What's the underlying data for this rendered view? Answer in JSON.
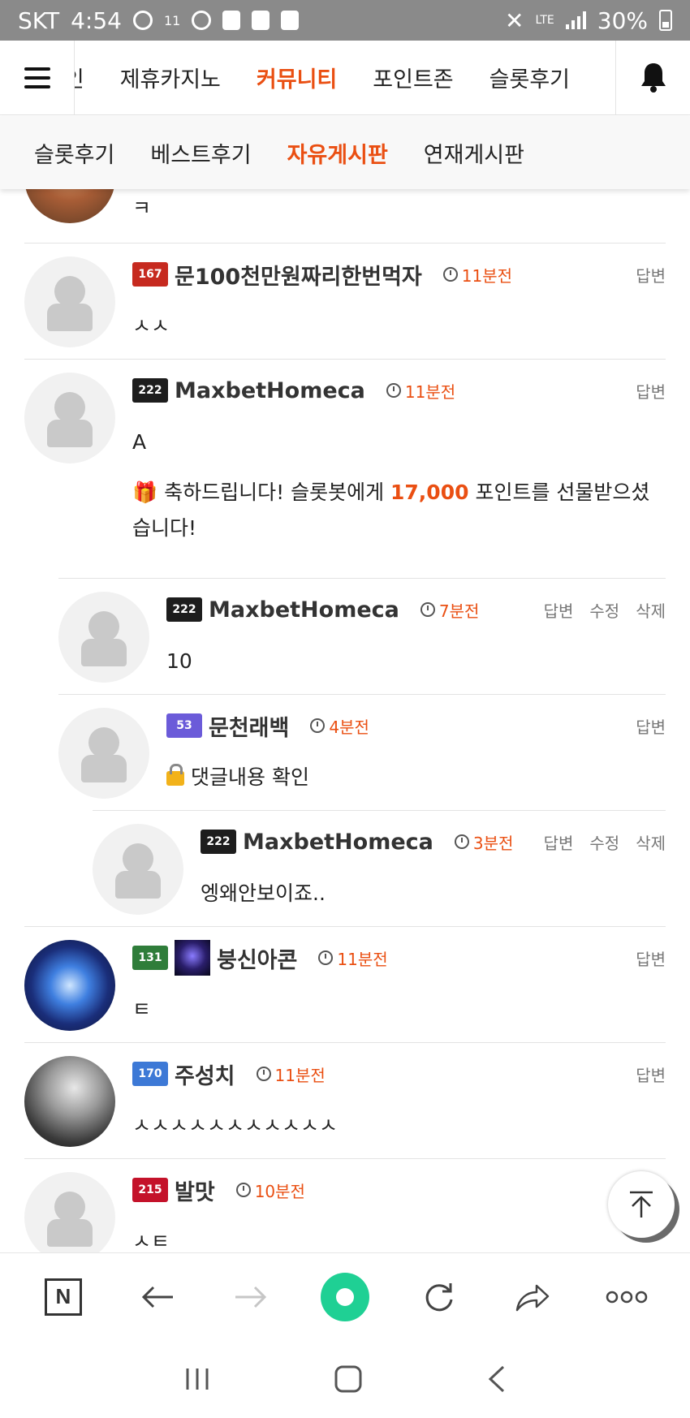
{
  "status_bar": {
    "carrier": "SKT",
    "time": "4:54",
    "indicator": "11",
    "network": "LTE",
    "battery": "30%"
  },
  "main_nav": {
    "items": [
      "메인",
      "제휴카지노",
      "커뮤니티",
      "포인트존",
      "슬롯후기"
    ],
    "active": "커뮤니티"
  },
  "sub_nav": {
    "items": [
      "슬롯후기",
      "베스트후기",
      "자유게시판",
      "연재게시판"
    ],
    "active": "자유게시판"
  },
  "comments": [
    {
      "text": "ㅋ"
    },
    {
      "level": "167",
      "username": "문100천만원짜리한번먹자",
      "time": "11분전",
      "text": "ㅅㅅ",
      "actions": [
        "답변"
      ]
    },
    {
      "level": "222",
      "username": "MaxbetHomeca",
      "time": "11분전",
      "text": "A",
      "gift": {
        "prefix": "축하드립니다! 슬롯봇에게 ",
        "points": "17,000",
        "suffix": " 포인트를 선물받으셨습니다!"
      },
      "actions": [
        "답변"
      ]
    },
    {
      "level": "222",
      "username": "MaxbetHomeca",
      "time": "7분전",
      "text": "10",
      "actions": [
        "답변",
        "수정",
        "삭제"
      ]
    },
    {
      "level": "53",
      "username": "문천래백",
      "time": "4분전",
      "text": "댓글내용 확인",
      "actions": [
        "답변"
      ]
    },
    {
      "level": "222",
      "username": "MaxbetHomeca",
      "time": "3분전",
      "text": "엥왜안보이죠..",
      "actions": [
        "답변",
        "수정",
        "삭제"
      ]
    },
    {
      "level": "131",
      "username": "붕신아콘",
      "time": "11분전",
      "text": "ㅌ",
      "actions": [
        "답변"
      ]
    },
    {
      "level": "170",
      "username": "주성치",
      "time": "11분전",
      "text": "ㅅㅅㅅㅅㅅㅅㅅㅅㅅㅅㅅ",
      "actions": [
        "답변"
      ]
    },
    {
      "level": "215",
      "username": "발맛",
      "time": "10분전",
      "text": "ㅅㅌ"
    }
  ],
  "colors": {
    "accent": "#ea4f12",
    "app_green": "#1fd094"
  }
}
